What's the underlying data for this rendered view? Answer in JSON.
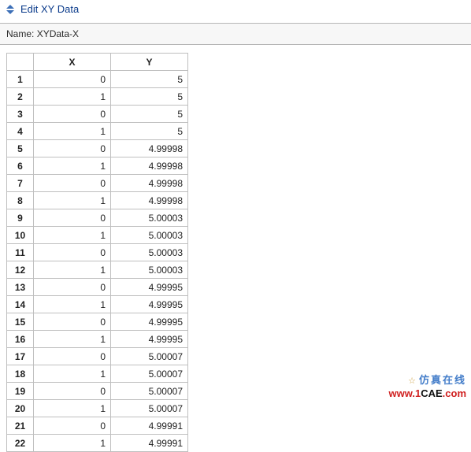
{
  "window": {
    "title": "Edit XY Data"
  },
  "nameBar": {
    "label": "Name:",
    "value": "XYData-X"
  },
  "table": {
    "headers": {
      "index": "",
      "x": "X",
      "y": "Y"
    },
    "rows": [
      {
        "i": "1",
        "x": "0",
        "y": "5"
      },
      {
        "i": "2",
        "x": "1",
        "y": "5"
      },
      {
        "i": "3",
        "x": "0",
        "y": "5"
      },
      {
        "i": "4",
        "x": "1",
        "y": "5"
      },
      {
        "i": "5",
        "x": "0",
        "y": "4.99998"
      },
      {
        "i": "6",
        "x": "1",
        "y": "4.99998"
      },
      {
        "i": "7",
        "x": "0",
        "y": "4.99998"
      },
      {
        "i": "8",
        "x": "1",
        "y": "4.99998"
      },
      {
        "i": "9",
        "x": "0",
        "y": "5.00003"
      },
      {
        "i": "10",
        "x": "1",
        "y": "5.00003"
      },
      {
        "i": "11",
        "x": "0",
        "y": "5.00003"
      },
      {
        "i": "12",
        "x": "1",
        "y": "5.00003"
      },
      {
        "i": "13",
        "x": "0",
        "y": "4.99995"
      },
      {
        "i": "14",
        "x": "1",
        "y": "4.99995"
      },
      {
        "i": "15",
        "x": "0",
        "y": "4.99995"
      },
      {
        "i": "16",
        "x": "1",
        "y": "4.99995"
      },
      {
        "i": "17",
        "x": "0",
        "y": "5.00007"
      },
      {
        "i": "18",
        "x": "1",
        "y": "5.00007"
      },
      {
        "i": "19",
        "x": "0",
        "y": "5.00007"
      },
      {
        "i": "20",
        "x": "1",
        "y": "5.00007"
      },
      {
        "i": "21",
        "x": "0",
        "y": "4.99991"
      },
      {
        "i": "22",
        "x": "1",
        "y": "4.99991"
      }
    ]
  },
  "watermark": {
    "star": "☆",
    "cn": "仿真在线",
    "url_prefix": "www.1",
    "url_mid": "CAE",
    "url_suffix": ".com"
  }
}
